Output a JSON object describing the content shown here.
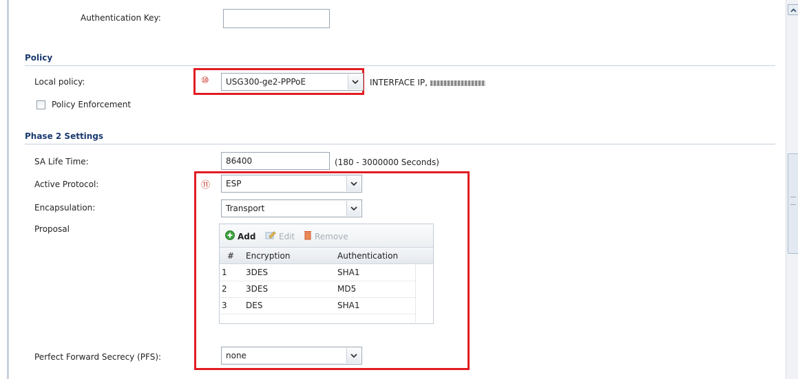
{
  "auth": {
    "key_label": "Authentication Key:",
    "key_value": ""
  },
  "policy": {
    "title": "Policy",
    "local_policy_label": "Local policy:",
    "marker": "⑩",
    "local_policy_value": "USG300-ge2-PPPoE",
    "interface_ip_label": "INTERFACE IP,",
    "policy_enforcement_label": "Policy Enforcement",
    "policy_enforcement_checked": false
  },
  "phase2": {
    "title": "Phase 2 Settings",
    "sa_life_label": "SA Life Time:",
    "sa_life_value": "86400",
    "sa_life_hint": "(180 - 3000000 Seconds)",
    "marker": "⑪",
    "active_protocol_label": "Active Protocol:",
    "active_protocol_value": "ESP",
    "encapsulation_label": "Encapsulation:",
    "encapsulation_value": "Transport",
    "proposal_label": "Proposal",
    "pfs_label": "Perfect Forward Secrecy (PFS):",
    "pfs_value": "none"
  },
  "proposal_grid": {
    "toolbar": {
      "add": "Add",
      "edit": "Edit",
      "remove": "Remove"
    },
    "columns": [
      "#",
      "Encryption",
      "Authentication"
    ],
    "rows": [
      {
        "num": "1",
        "encryption": "3DES",
        "authentication": "SHA1"
      },
      {
        "num": "2",
        "encryption": "3DES",
        "authentication": "MD5"
      },
      {
        "num": "3",
        "encryption": "DES",
        "authentication": "SHA1"
      }
    ]
  },
  "icons": {
    "add": "add-icon",
    "edit": "edit-icon",
    "remove": "trash-icon",
    "dropdown": "chevron-down-icon",
    "scroll_up": "arrow-up-icon"
  },
  "colors": {
    "highlight": "#e11b22",
    "section_title": "#1a3a6e"
  }
}
